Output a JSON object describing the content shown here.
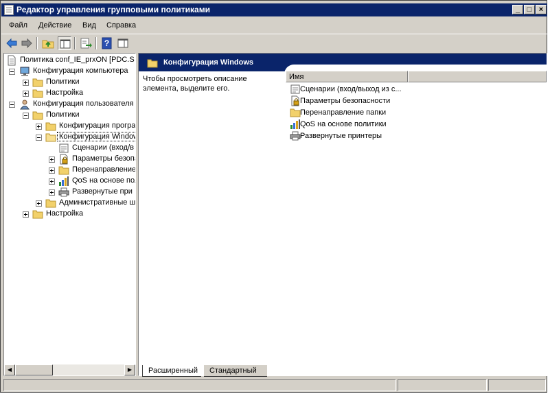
{
  "window": {
    "title": "Редактор управления групповыми политиками"
  },
  "menu": [
    "Файл",
    "Действие",
    "Вид",
    "Справка"
  ],
  "tree": {
    "root": "Политика conf_IE_prxON [PDC.S",
    "computer_config": "Конфигурация компьютера",
    "computer_policies": "Политики",
    "computer_settings": "Настройка",
    "user_config": "Конфигурация пользователя",
    "user_policies": "Политики",
    "software_config": "Конфигурация програ",
    "windows_config": "Конфигурация Window",
    "scripts": "Сценарии (вход/в",
    "security": "Параметры безопа",
    "redirection": "Перенаправление",
    "qos": "QoS на основе пол",
    "printers": "Развернутые при",
    "admin_templates": "Административные ш",
    "user_settings": "Настройка"
  },
  "content": {
    "header": "Конфигурация Windows",
    "description": "Чтобы просмотреть описание элемента, выделите его.",
    "column_name": "Имя",
    "items": [
      {
        "label": "Сценарии (вход/выход из с...",
        "icon": "script-icon"
      },
      {
        "label": "Параметры безопасности",
        "icon": "security-settings-icon"
      },
      {
        "label": "Перенаправление папки",
        "icon": "folder-icon"
      },
      {
        "label": "QoS на основе политики",
        "icon": "qos-chart-icon"
      },
      {
        "label": "Развернутые принтеры",
        "icon": "printer-icon"
      }
    ]
  },
  "tabs": {
    "extended": "Расширенный",
    "standard": "Стандартный"
  },
  "colors": {
    "titlebar": "#0a246a",
    "face": "#d4d0c8",
    "folder": "#f2d16b"
  }
}
